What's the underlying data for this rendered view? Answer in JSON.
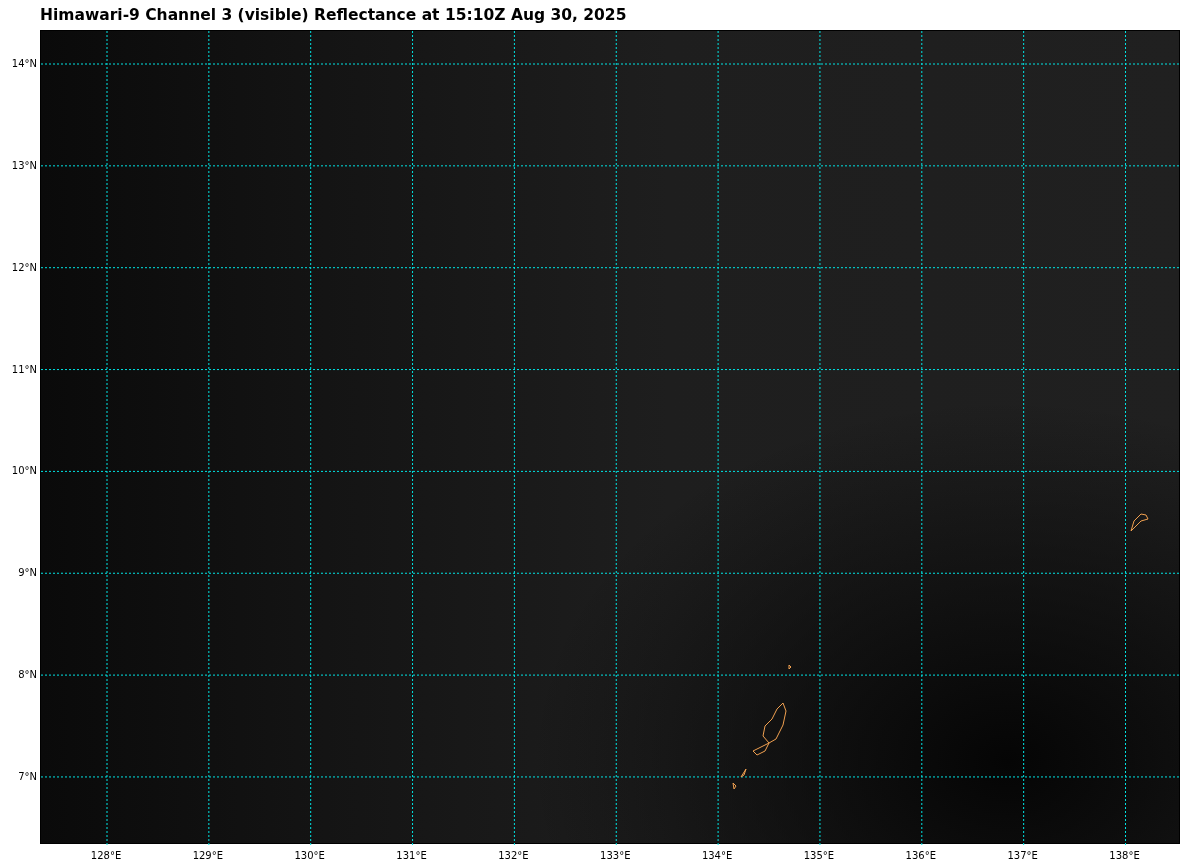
{
  "title": "Himawari-9 Channel 3 (visible) Reflectance at 15:10Z Aug 30, 2025",
  "map": {
    "lat_labels": [
      "14°N",
      "13°N",
      "12°N",
      "11°N",
      "10°N",
      "9°N",
      "8°N",
      "7°N"
    ],
    "lon_labels": [
      "128°E",
      "129°E",
      "130°E",
      "131°E",
      "132°E",
      "133°E",
      "134°E",
      "135°E",
      "136°E",
      "137°E",
      "138°E"
    ]
  }
}
